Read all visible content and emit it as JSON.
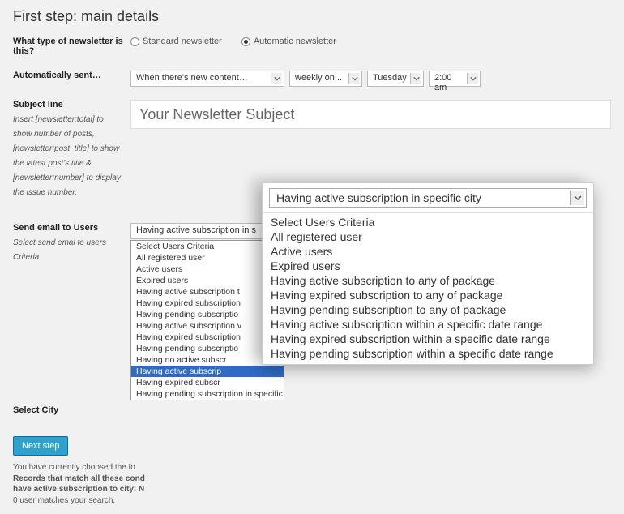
{
  "title": "First step: main details",
  "rows": {
    "type": {
      "label": "What type of newsletter is this?",
      "options": {
        "std": "Standard newsletter",
        "auto": "Automatic newsletter"
      }
    },
    "autosent": {
      "label": "Automatically sent…",
      "trigger": "When there's new content…",
      "freq": "weekly on...",
      "day": "Tuesday",
      "time": "2:00 am"
    },
    "subject": {
      "label": "Subject line",
      "hint": "Insert [newsletter:total] to show number of posts, [newsletter:post_title] to show the latest post's title & [newsletter:number] to display the issue number.",
      "value": "Your Newsletter Subject"
    },
    "sendto": {
      "label": "Send email to Users",
      "hint": "Select send emal to users Criteria",
      "selected": "Having active subscription in s",
      "options": [
        "Select Users Criteria",
        "All registered user",
        "Active users",
        "Expired users",
        "Having active subscription t",
        "Having expired subscription",
        "Having pending subscriptio",
        "Having active subscription v",
        "Having expired subscription",
        "Having pending subscriptio",
        "Having no active subscr",
        "Having active subscrip",
        "Having expired subscr",
        "Having pending subscription in specific city"
      ],
      "highlight_index": 11
    },
    "city": {
      "label": "Select City"
    }
  },
  "button": "Next step",
  "footer": {
    "line1": "You have currently choosed the fo",
    "line2": "Records that match all these cond",
    "line3": "have active subscription to city: N",
    "line4": "0 user matches your search."
  },
  "popup": {
    "selected": "Having active subscription in specific city",
    "options": [
      "Select Users Criteria",
      "All registered user",
      "Active users",
      "Expired users",
      "Having active subscription to any of package",
      "Having expired subscription to any of package",
      "Having pending subscription to any of package",
      "Having active subscription within a specific date range",
      "Having expired subscription within a specific date range",
      "Having pending subscription within a specific date range"
    ]
  }
}
